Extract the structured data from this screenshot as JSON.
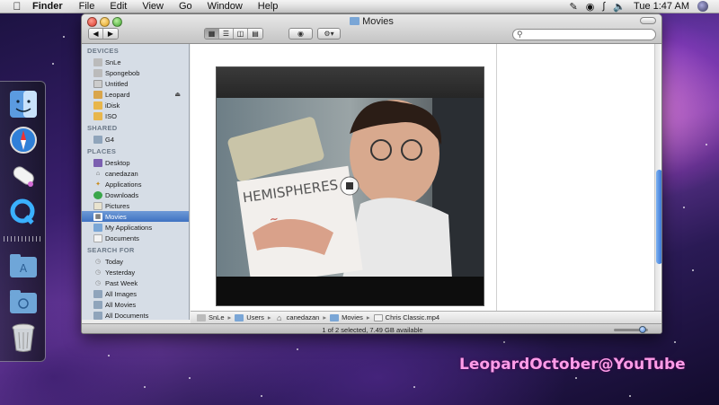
{
  "menubar": {
    "apple_icon": "apple-icon",
    "app_name": "Finder",
    "menus": [
      "File",
      "Edit",
      "View",
      "Go",
      "Window",
      "Help"
    ],
    "clock": "Tue 1:47 AM"
  },
  "window": {
    "title": "Movies",
    "search_placeholder": ""
  },
  "sidebar": {
    "devices_heading": "DEVICES",
    "devices": [
      "SnLe",
      "Spongebob",
      "Untitled",
      "Leopard",
      "iDisk",
      "ISO"
    ],
    "shared_heading": "SHARED",
    "shared": [
      "G4"
    ],
    "places_heading": "PLACES",
    "places": [
      "Desktop",
      "canedazan",
      "Applications",
      "Downloads",
      "Pictures",
      "Movies",
      "My Applications",
      "Documents"
    ],
    "search_heading": "SEARCH FOR",
    "searches": [
      "Today",
      "Yesterday",
      "Past Week",
      "All Images",
      "All Movies",
      "All Documents"
    ]
  },
  "pathbar": [
    "SnLe",
    "Users",
    "canedazan",
    "Movies",
    "Chris Classic.mp4"
  ],
  "status": "1 of 2 selected, 7.49 GB available",
  "zoom_level": 0.85,
  "video": {
    "magazine_text": "HEMISPHERES"
  },
  "watermark": "LeopardOctober@YouTube",
  "colors": {
    "accent": "#3f72c2",
    "watermark": "#ff9de8"
  }
}
